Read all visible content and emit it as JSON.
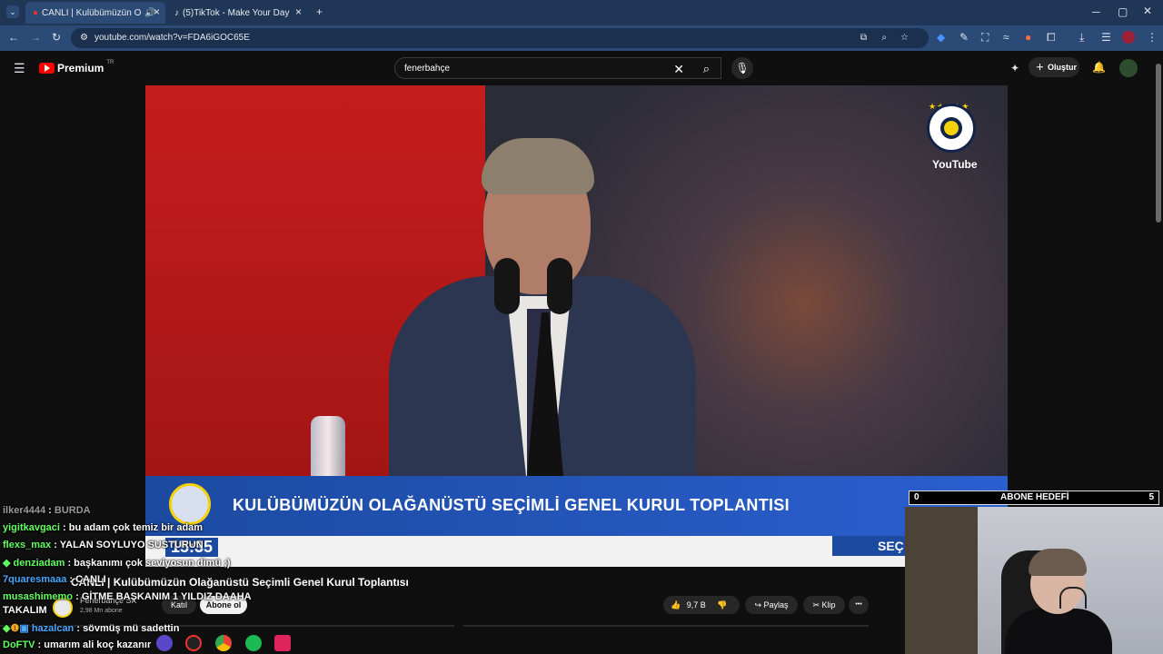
{
  "browser": {
    "tabs": [
      {
        "label": "CANLI | Kulübümüzün O",
        "active": true
      },
      {
        "label": "(5)TikTok - Make Your Day",
        "active": false
      }
    ],
    "new_tab": "+",
    "url": "youtube.com/watch?v=FDA6iGOC65E"
  },
  "youtube": {
    "logo": "Premium",
    "logo_badge": "TR",
    "search_value": "fenerbahçe",
    "create_label": "Oluştur"
  },
  "video": {
    "watermark": "YouTube",
    "lower_third": "KULÜBÜMÜZÜN OLAĞANÜSTÜ SEÇİMLİ GENEL KURUL TOPLANTISI",
    "clock": "15:35",
    "right_label": "SEÇ"
  },
  "overlay": {
    "sub_goal_left": "0",
    "sub_goal_label": "ABONE HEDEFİ",
    "sub_goal_right": "5"
  },
  "chat": [
    {
      "user": "ilker4444",
      "msg": "BURDA",
      "color": "#9a9a9a"
    },
    {
      "user": "yigitkavgaci",
      "msg": "bu adam çok temiz bir adam",
      "color": "#62ff62"
    },
    {
      "user": "flexs_max",
      "msg": "YALAN SOYLUYO SUSTURUN",
      "color": "#62ff62"
    },
    {
      "user": "denziadam",
      "msg": "başkanımı çok seviyosun dimü ;)",
      "color": "#62ff62"
    },
    {
      "user": "7quaresmaaa",
      "msg": "CANLI",
      "color": "#4aa8ff"
    },
    {
      "user": "musashimemo",
      "msg": "GİTME BAŞKANIM 1 YILDIZ DAAHA",
      "color": "#62ff62"
    },
    {
      "user": "",
      "msg": "TAKALIM",
      "color": "#ffffff"
    },
    {
      "user": "hazalcan",
      "msg": "sövmüş mü sadettin",
      "color": "#4aa8ff"
    },
    {
      "user": "DoFTV",
      "msg": "umarım ali koç kazanır",
      "color": "#62ff62"
    }
  ],
  "below_video": {
    "title": "CANLI | Kulübümüzün Olağanüstü Seçimli Genel Kurul Toplantısı",
    "channel": "Fenerbahçe SK",
    "subscribers": "2,98 Mn abone",
    "join": "Katıl",
    "subscribe": "Abone ol",
    "likes": "9,7 B",
    "share": "Paylaş",
    "clip": "Klip",
    "more": "•••"
  }
}
